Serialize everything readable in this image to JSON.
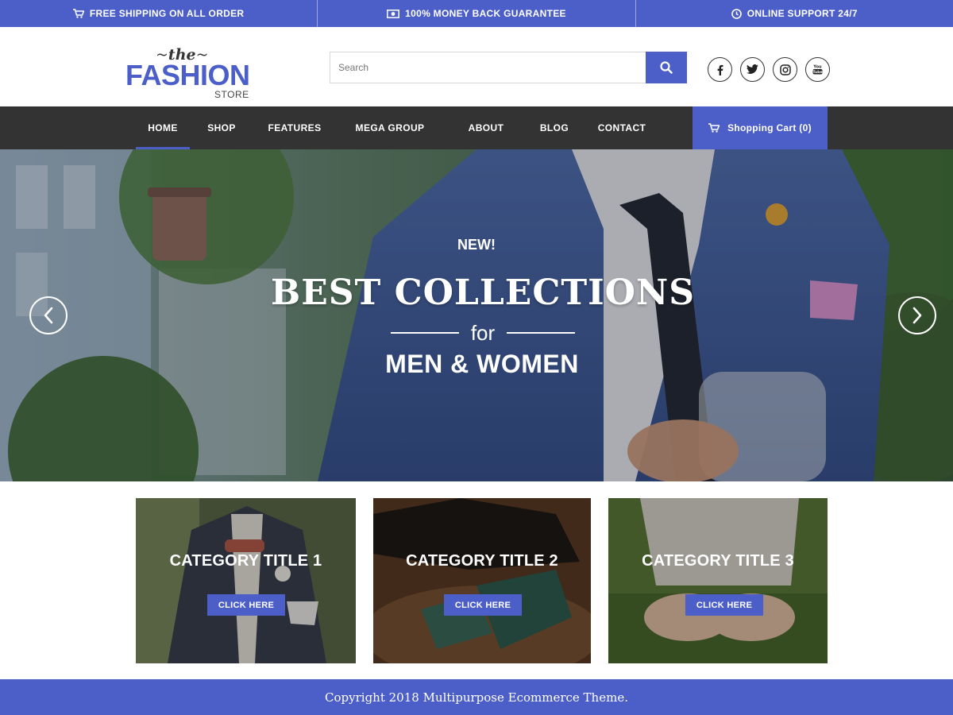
{
  "topbar": {
    "items": [
      {
        "icon": "cart-icon",
        "label": "FREE SHIPPING ON ALL ORDER"
      },
      {
        "icon": "money-icon",
        "label": "100% MONEY BACK GUARANTEE"
      },
      {
        "icon": "clock-icon",
        "label": "ONLINE SUPPORT 24/7"
      }
    ]
  },
  "logo": {
    "the": "the",
    "tilde": "~",
    "fashion": "FASHION",
    "store": "STORE"
  },
  "search": {
    "placeholder": "Search",
    "value": "",
    "button_icon": "search-icon"
  },
  "socials": [
    "facebook-icon",
    "twitter-icon",
    "instagram-icon",
    "youtube-icon"
  ],
  "nav": {
    "items": [
      "HOME",
      "SHOP",
      "FEATURES",
      "MEGA GROUP",
      "ABOUT",
      "BLOG",
      "CONTACT"
    ],
    "active": "HOME"
  },
  "cart": {
    "label": "Shopping Cart (0)",
    "icon": "cart-icon"
  },
  "hero": {
    "kicker": "NEW!",
    "title": "BEST COLLECTIONS",
    "connector": "for",
    "subtitle": "MEN & WOMEN",
    "prev_icon": "chevron-left-icon",
    "next_icon": "chevron-right-icon"
  },
  "categories": [
    {
      "title": "CATEGORY TITLE 1",
      "button": "CLICK HERE"
    },
    {
      "title": "CATEGORY TITLE 2",
      "button": "CLICK HERE"
    },
    {
      "title": "CATEGORY TITLE 3",
      "button": "CLICK HERE"
    }
  ],
  "footer": {
    "text": "Copyright 2018 Multipurpose Ecommerce Theme."
  },
  "colors": {
    "accent": "#4c5fc9",
    "nav_bg": "#333333",
    "white": "#ffffff"
  }
}
